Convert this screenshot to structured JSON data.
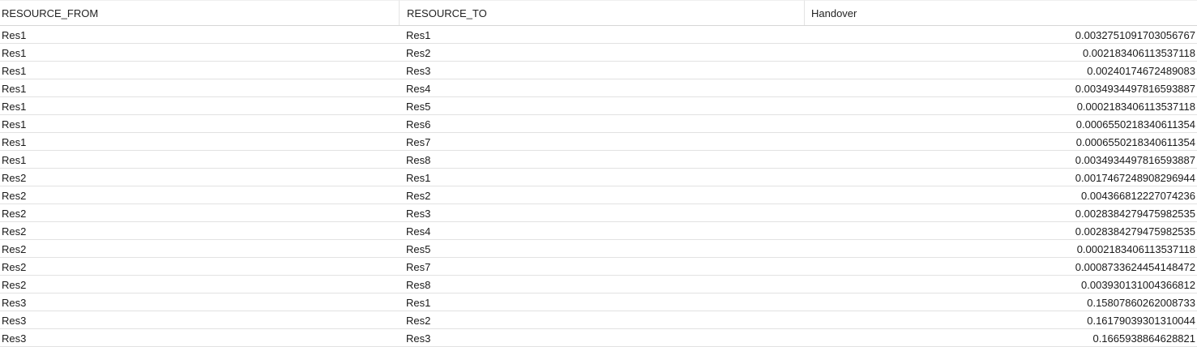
{
  "table": {
    "columns": [
      "RESOURCE_FROM",
      "RESOURCE_TO",
      "Handover"
    ],
    "rows": [
      [
        "Res1",
        "Res1",
        "0.0032751091703056767"
      ],
      [
        "Res1",
        "Res2",
        "0.002183406113537118"
      ],
      [
        "Res1",
        "Res3",
        "0.00240174672489083"
      ],
      [
        "Res1",
        "Res4",
        "0.0034934497816593887"
      ],
      [
        "Res1",
        "Res5",
        "0.0002183406113537118"
      ],
      [
        "Res1",
        "Res6",
        "0.0006550218340611354"
      ],
      [
        "Res1",
        "Res7",
        "0.0006550218340611354"
      ],
      [
        "Res1",
        "Res8",
        "0.0034934497816593887"
      ],
      [
        "Res2",
        "Res1",
        "0.0017467248908296944"
      ],
      [
        "Res2",
        "Res2",
        "0.004366812227074236"
      ],
      [
        "Res2",
        "Res3",
        "0.0028384279475982535"
      ],
      [
        "Res2",
        "Res4",
        "0.0028384279475982535"
      ],
      [
        "Res2",
        "Res5",
        "0.0002183406113537118"
      ],
      [
        "Res2",
        "Res7",
        "0.0008733624454148472"
      ],
      [
        "Res2",
        "Res8",
        "0.003930131004366812"
      ],
      [
        "Res3",
        "Res1",
        "0.15807860262008733"
      ],
      [
        "Res3",
        "Res2",
        "0.16179039301310044"
      ],
      [
        "Res3",
        "Res3",
        "0.1665938864628821"
      ]
    ]
  }
}
